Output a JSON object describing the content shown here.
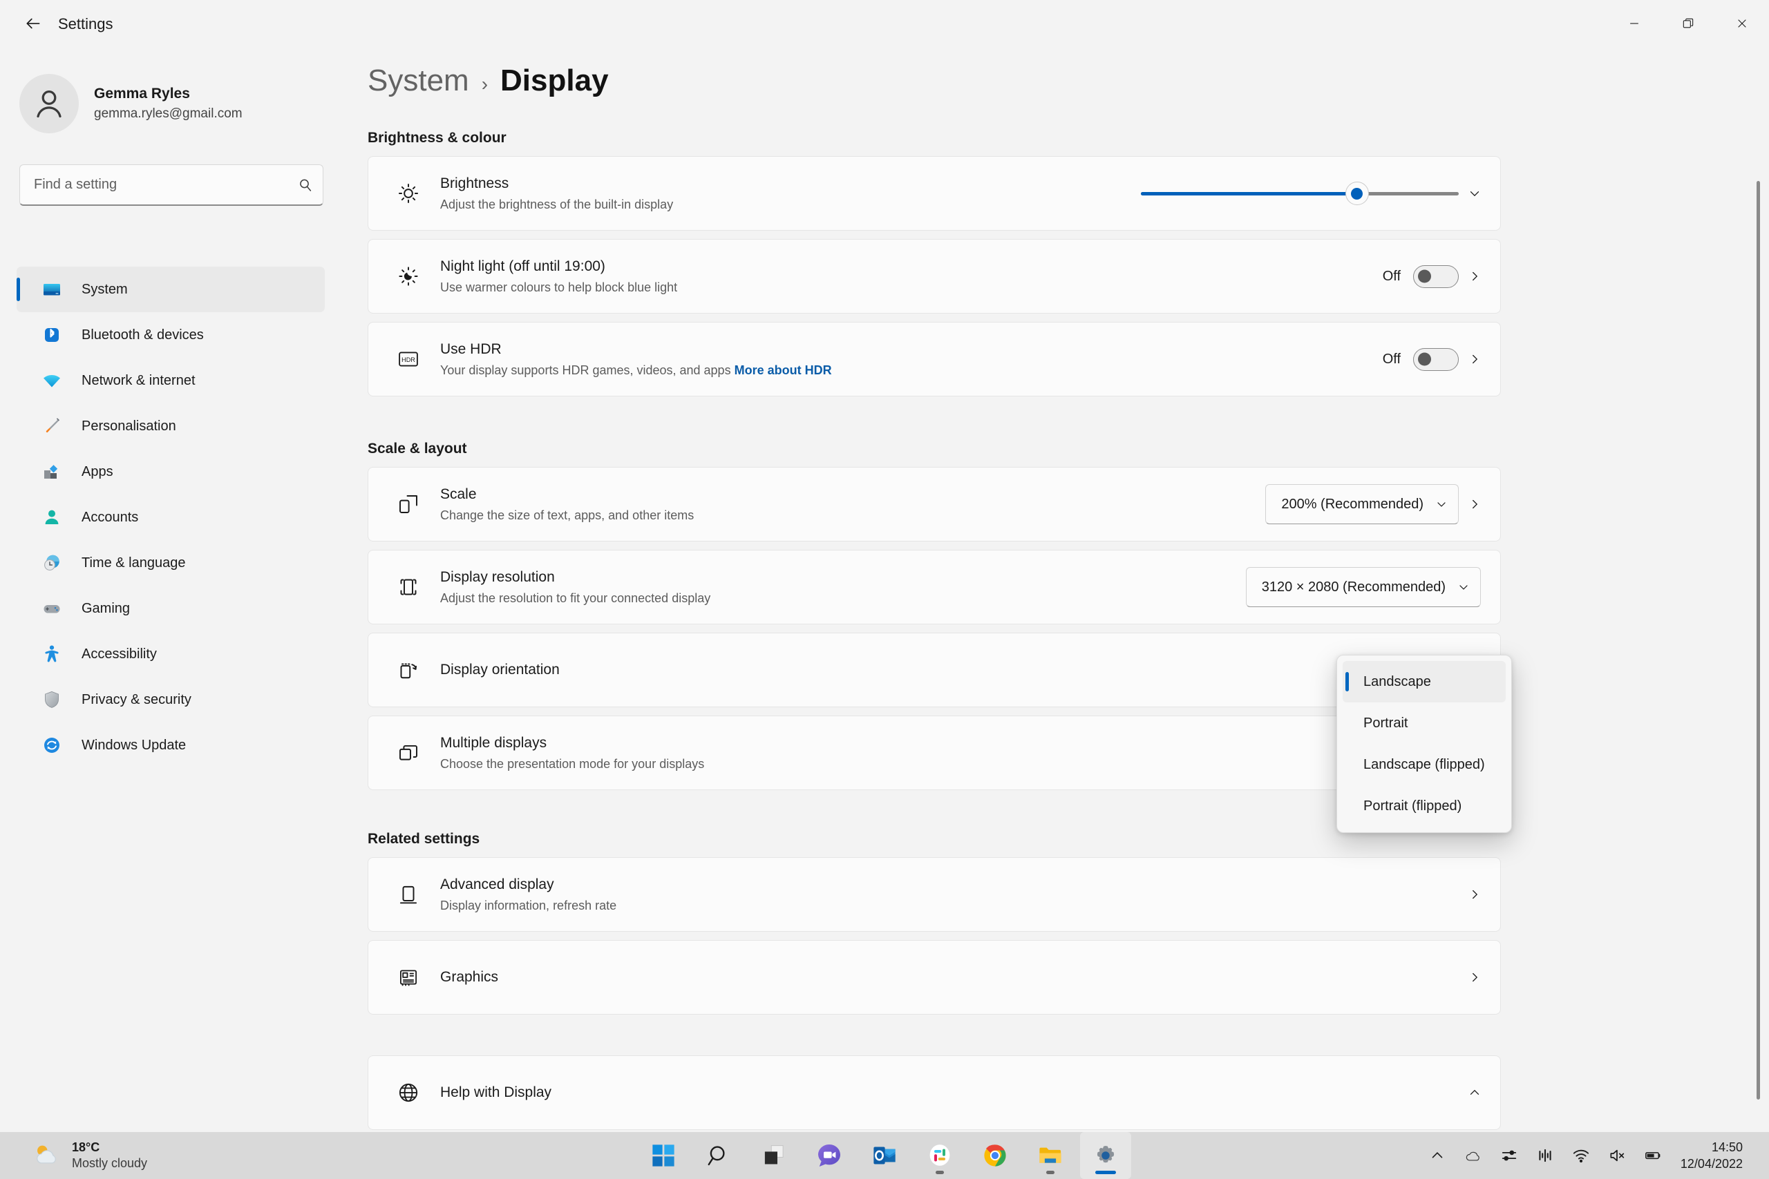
{
  "window": {
    "title": "Settings",
    "back_label": "Back",
    "minimize_label": "Minimise",
    "maximize_label": "Restore",
    "close_label": "Close"
  },
  "account": {
    "name": "Gemma Ryles",
    "email": "gemma.ryles@gmail.com"
  },
  "search": {
    "placeholder": "Find a setting",
    "value": ""
  },
  "sidebar": {
    "items": [
      {
        "label": "System",
        "icon": "system-icon",
        "active": true
      },
      {
        "label": "Bluetooth & devices",
        "icon": "bluetooth-icon",
        "active": false
      },
      {
        "label": "Network & internet",
        "icon": "wifi-icon",
        "active": false
      },
      {
        "label": "Personalisation",
        "icon": "paintbrush-icon",
        "active": false
      },
      {
        "label": "Apps",
        "icon": "apps-icon",
        "active": false
      },
      {
        "label": "Accounts",
        "icon": "accounts-icon",
        "active": false
      },
      {
        "label": "Time & language",
        "icon": "clock-globe-icon",
        "active": false
      },
      {
        "label": "Gaming",
        "icon": "gamepad-icon",
        "active": false
      },
      {
        "label": "Accessibility",
        "icon": "accessibility-icon",
        "active": false
      },
      {
        "label": "Privacy & security",
        "icon": "shield-icon",
        "active": false
      },
      {
        "label": "Windows Update",
        "icon": "update-icon",
        "active": false
      }
    ]
  },
  "breadcrumb": {
    "parent": "System",
    "separator": "›",
    "current": "Display"
  },
  "sections": {
    "brightness_colour": {
      "title": "Brightness & colour",
      "brightness": {
        "title": "Brightness",
        "subtitle": "Adjust the brightness of the built-in display",
        "value_percent": 68
      },
      "night_light": {
        "title": "Night light (off until 19:00)",
        "subtitle": "Use warmer colours to help block blue light",
        "state": "Off"
      },
      "hdr": {
        "title": "Use HDR",
        "subtitle": "Your display supports HDR games, videos, and apps",
        "link": "More about HDR",
        "state": "Off"
      }
    },
    "scale_layout": {
      "title": "Scale & layout",
      "scale": {
        "title": "Scale",
        "subtitle": "Change the size of text, apps, and other items",
        "value": "200% (Recommended)"
      },
      "resolution": {
        "title": "Display resolution",
        "subtitle": "Adjust the resolution to fit your connected display",
        "value": "3120 × 2080 (Recommended)"
      },
      "orientation": {
        "title": "Display orientation",
        "value": "Landscape",
        "options": [
          "Landscape",
          "Portrait",
          "Landscape (flipped)",
          "Portrait (flipped)"
        ]
      },
      "multiple_displays": {
        "title": "Multiple displays",
        "subtitle": "Choose the presentation mode for your displays"
      }
    },
    "related_settings": {
      "title": "Related settings",
      "advanced_display": {
        "title": "Advanced display",
        "subtitle": "Display information, refresh rate"
      },
      "graphics": {
        "title": "Graphics"
      }
    },
    "help": {
      "title": "Help with Display"
    }
  },
  "taskbar": {
    "weather": {
      "temperature": "18°C",
      "condition": "Mostly cloudy"
    },
    "apps": [
      {
        "name": "start-button",
        "label": "Start"
      },
      {
        "name": "search-button",
        "label": "Search"
      },
      {
        "name": "task-view-button",
        "label": "Task View"
      },
      {
        "name": "teams-button",
        "label": "Microsoft Teams"
      },
      {
        "name": "outlook-button",
        "label": "Outlook"
      },
      {
        "name": "slack-button",
        "label": "Slack"
      },
      {
        "name": "chrome-button",
        "label": "Google Chrome"
      },
      {
        "name": "file-explorer-button",
        "label": "File Explorer"
      },
      {
        "name": "settings-button",
        "label": "Settings"
      }
    ],
    "tray": [
      {
        "name": "show-hidden-icons-button",
        "label": "Show hidden icons"
      },
      {
        "name": "onedrive-icon",
        "label": "OneDrive"
      },
      {
        "name": "settings-sliders-icon",
        "label": "Adjustments"
      },
      {
        "name": "equalizer-icon",
        "label": "Equalizer"
      },
      {
        "name": "wifi-icon",
        "label": "Network"
      },
      {
        "name": "volume-muted-icon",
        "label": "Volume muted"
      },
      {
        "name": "battery-icon",
        "label": "Battery"
      }
    ],
    "clock": {
      "time": "14:50",
      "date": "12/04/2022"
    }
  },
  "colors": {
    "accent": "#0067c0",
    "slider_fill": "#0060ba",
    "link": "#0a5ca8",
    "window_bg": "#f3f3f3",
    "card_bg": "#fbfbfb",
    "taskbar_bg": "#d9d9d9"
  }
}
